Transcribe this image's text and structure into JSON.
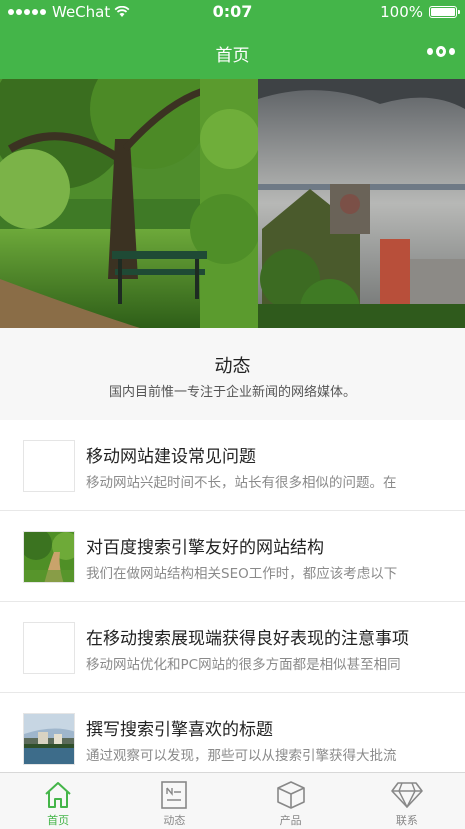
{
  "status_bar": {
    "carrier": "WeChat",
    "time": "0:07",
    "battery": "100%"
  },
  "nav": {
    "title": "首页"
  },
  "section": {
    "title": "动态",
    "subtitle": "国内目前惟一专注于企业新闻的网络媒体。"
  },
  "articles": [
    {
      "title": "移动网站建设常见问题",
      "desc": "移动网站兴起时间不长，站长有很多相似的问题。在"
    },
    {
      "title": "对百度搜索引擎友好的网站结构",
      "desc": "我们在做网站结构相关SEO工作时，都应该考虑以下"
    },
    {
      "title": "在移动搜索展现端获得良好表现的注意事项",
      "desc": "移动网站优化和PC网站的很多方面都是相似甚至相同"
    },
    {
      "title": "撰写搜索引擎喜欢的标题",
      "desc": "通过观察可以发现，那些可以从搜索引擎获得大批流"
    }
  ],
  "tabs": [
    {
      "label": "首页",
      "icon": "home-icon"
    },
    {
      "label": "动态",
      "icon": "news-icon"
    },
    {
      "label": "产品",
      "icon": "cube-icon"
    },
    {
      "label": "联系",
      "icon": "diamond-icon"
    }
  ],
  "colors": {
    "brand_green": "#44b549",
    "tab_inactive": "#888888"
  }
}
